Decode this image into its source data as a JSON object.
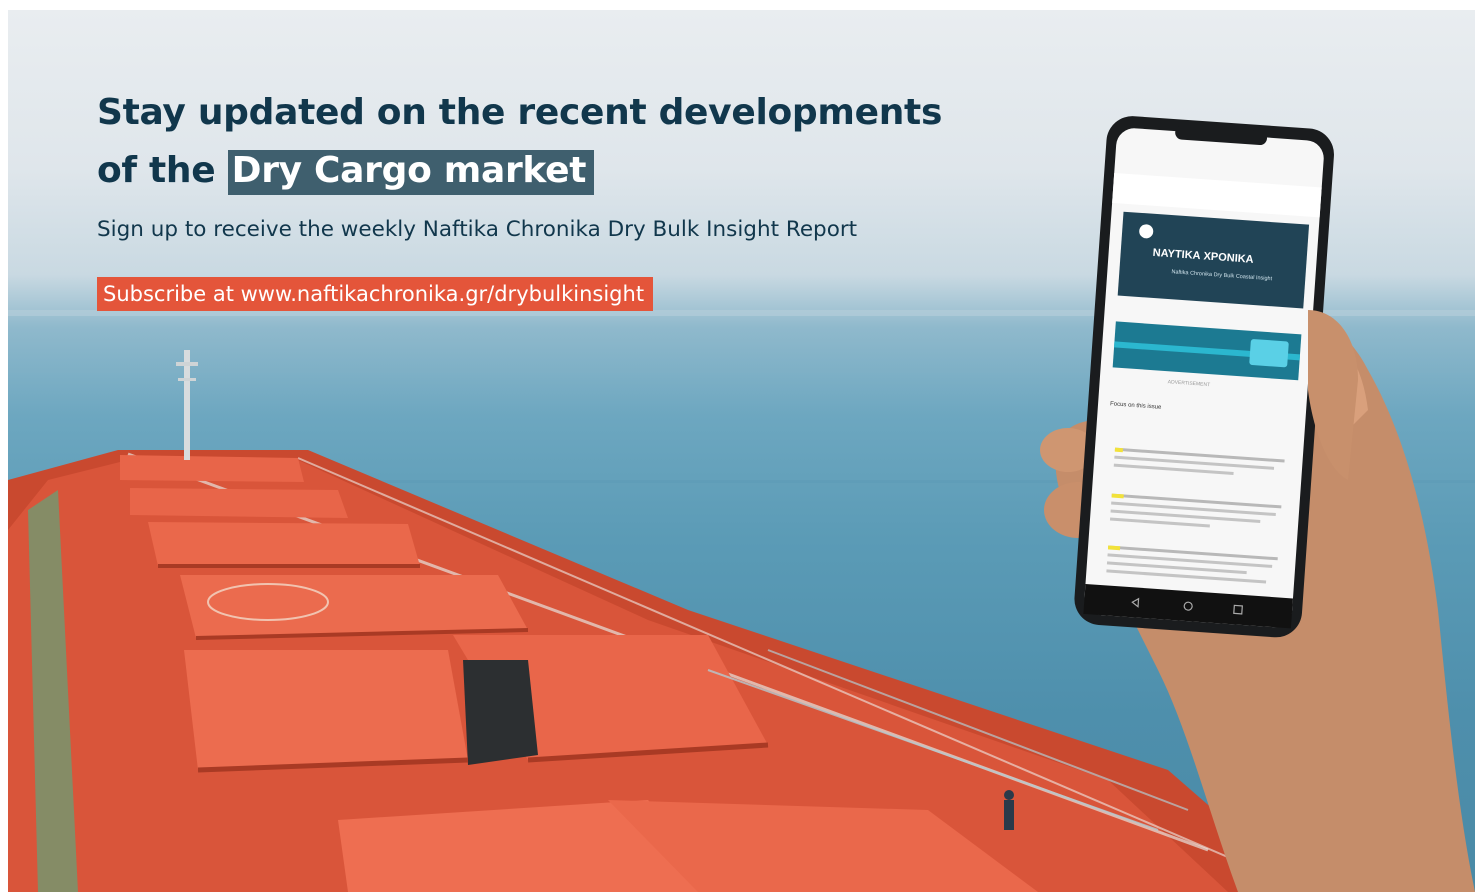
{
  "banner": {
    "headline_line1": "Stay updated on the recent developments",
    "headline_line2_prefix": "of the",
    "headline_highlight": "Dry Cargo market",
    "subheadline": "Sign up to receive the weekly Naftika Chronika Dry Bulk Insight Report",
    "cta_label": "Subscribe at www.naftikachronika.gr/drybulkinsight"
  },
  "phone": {
    "newsletter_brand": "ΝΑΥΤΙΚΑ ΧΡΟΝΙΚΑ",
    "newsletter_subtitle": "Naftika Chronika Dry Bulk Coastal Insight",
    "ad_label": "ADVERTISEMENT",
    "section_title": "Focus on this issue"
  },
  "colors": {
    "headline": "#11374c",
    "highlight_bg": "#3f5f6e",
    "cta_bg": "#e4553a",
    "deck": "#d9553a"
  }
}
